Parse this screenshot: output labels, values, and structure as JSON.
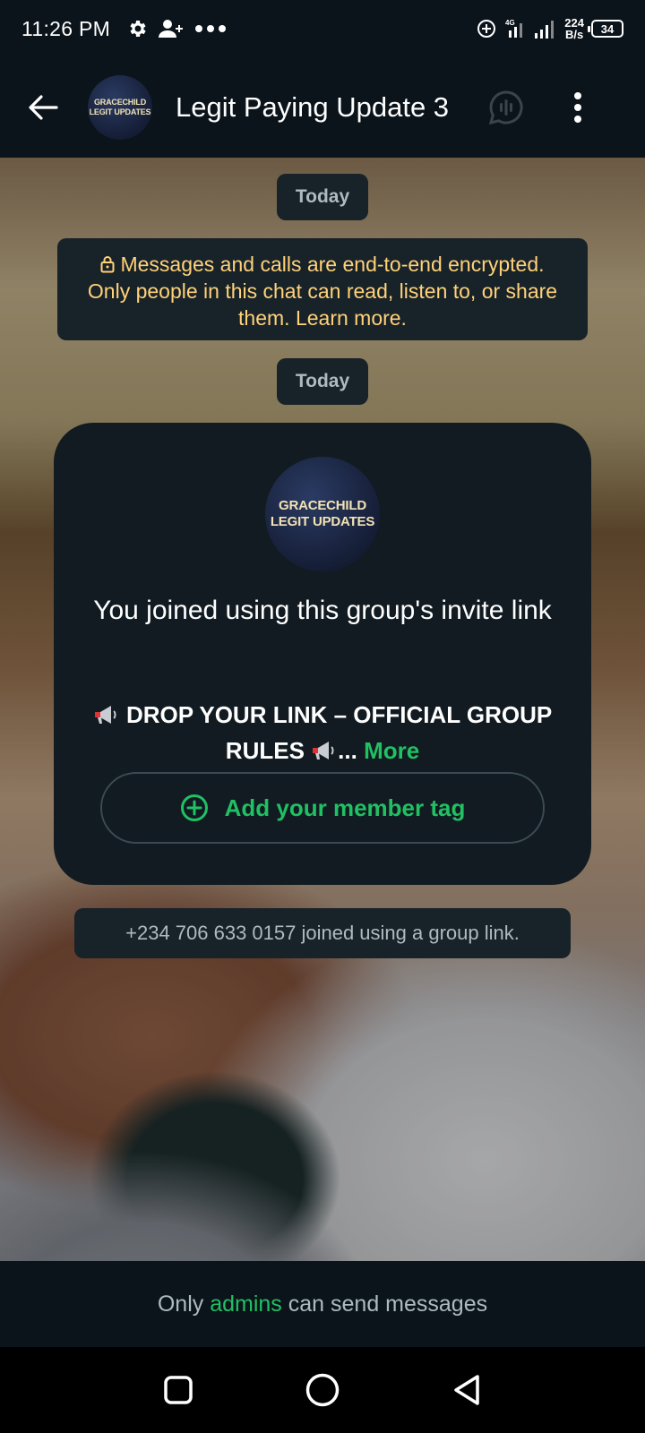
{
  "status_bar": {
    "time": "11:26 PM",
    "net_speed_value": "224",
    "net_speed_unit": "B/s",
    "network_type": "4G",
    "battery": "34",
    "icons": [
      "gear-icon",
      "add-contact-icon",
      "more-dots-icon",
      "data-saver-icon",
      "signal-icon",
      "battery-icon"
    ]
  },
  "header": {
    "title": "Legit Paying Update 3",
    "avatar_line1": "GRACECHILD",
    "avatar_line2": "LEGIT UPDATES"
  },
  "chat": {
    "date_label_1": "Today",
    "encryption_text": "Messages and calls are end-to-end encrypted. Only people in this chat can read, listen to, or share them. Learn more.",
    "date_label_2": "Today",
    "invite_card": {
      "avatar_line1": "GRACECHILD",
      "avatar_line2": "LEGIT UPDATES",
      "title": "You joined using this group's invite link",
      "description_main": "DROP YOUR LINK – OFFICIAL GROUP RULES",
      "description_ellipsis": "...",
      "more_label": "More",
      "member_tag_button": "Add your member tag"
    },
    "joined_notice": "+234 706 633 0157 joined using a group link."
  },
  "footer": {
    "prefix": "Only",
    "highlight": "admins",
    "suffix": "can send messages"
  },
  "colors": {
    "accent_green": "#21c063",
    "bubble_bg": "#182229",
    "bar_bg": "#0b141a",
    "encryption_text": "#ffd279"
  }
}
